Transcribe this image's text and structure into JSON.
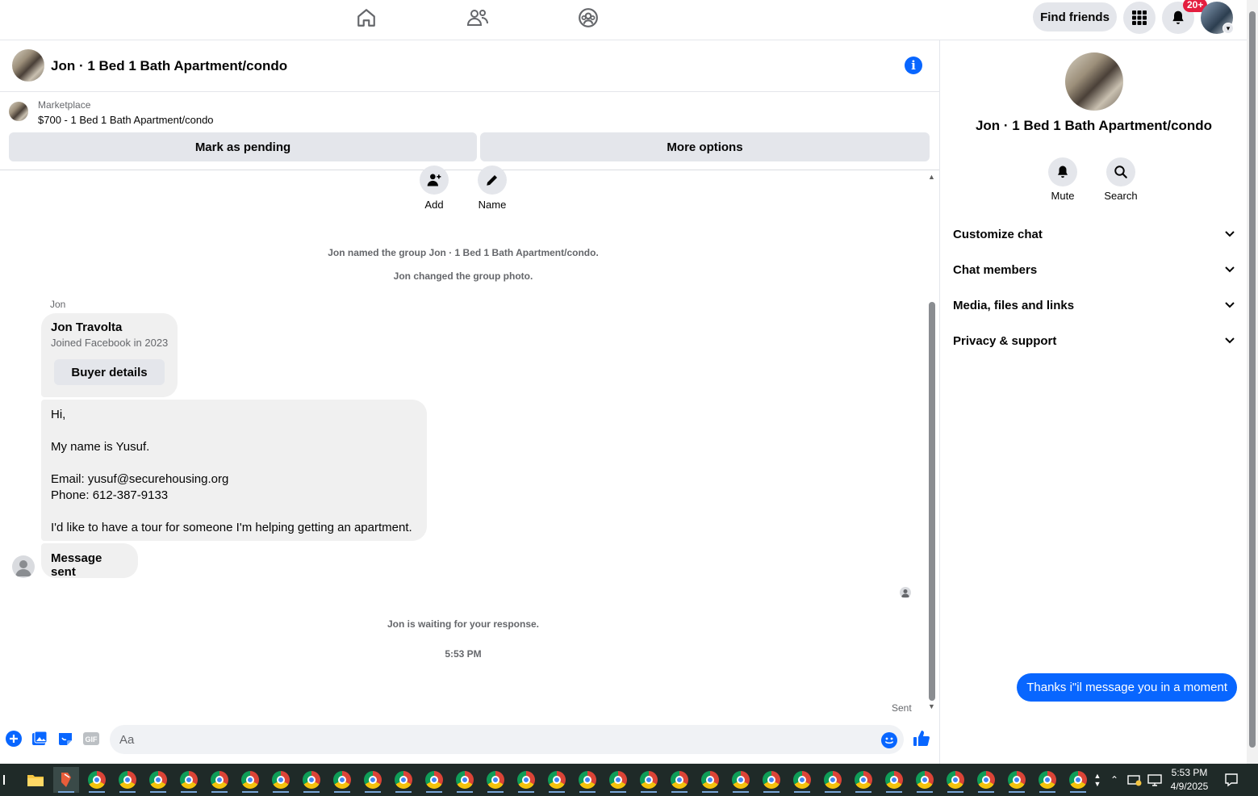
{
  "topnav": {
    "icons": [
      "home-icon",
      "friends-icon",
      "groups-icon"
    ],
    "find_friends": "Find friends",
    "notif_badge": "20+"
  },
  "chat": {
    "title": "Jon · 1 Bed 1 Bath Apartment/condo"
  },
  "marketplace": {
    "label": "Marketplace",
    "listing": "$700 - 1 Bed 1 Bath Apartment/condo",
    "mark_pending": "Mark as pending",
    "more_options": "More options"
  },
  "group_actions": {
    "add": "Add",
    "name": "Name"
  },
  "messages": {
    "system_1": "Jon named the group Jon · 1 Bed 1 Bath Apartment/condo.",
    "system_2": "Jon changed the group photo.",
    "sender": "Jon",
    "profile_name": "Jon Travolta",
    "profile_joined": "Joined Facebook in 2023",
    "buyer_details": "Buyer details",
    "body_lines": [
      "Hi,",
      "",
      "My name is Yusuf.",
      "",
      "Email: yusuf@securehousing.org",
      "Phone: 612-387-9133",
      "",
      "I'd like to have a tour for someone I'm helping getting an apartment."
    ],
    "message_sent": "Message sent",
    "waiting": "Jon is waiting for your response.",
    "timestamp": "5:53 PM",
    "outgoing": "Thanks i\"il message you in a moment",
    "status": "Sent"
  },
  "composer": {
    "placeholder": "Aa",
    "gif": "GIF"
  },
  "right_panel": {
    "title": "Jon · 1 Bed 1 Bath Apartment/condo",
    "mute": "Mute",
    "search": "Search",
    "sections": [
      "Customize chat",
      "Chat members",
      "Media, files and links",
      "Privacy & support"
    ]
  },
  "taskbar": {
    "time": "5:53 PM",
    "date": "4/9/2025"
  },
  "colors": {
    "accent": "#0866ff",
    "bubble_in": "#f0f0f0",
    "button_bg": "#e4e6eb",
    "badge": "#e41e3f",
    "taskbar": "#1f2a28"
  }
}
